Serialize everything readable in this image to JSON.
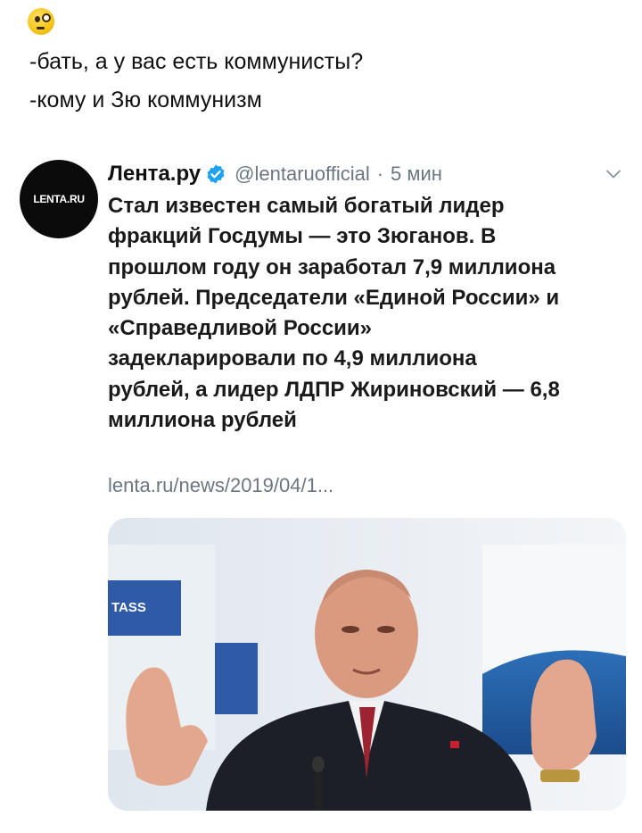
{
  "post": {
    "emoji_icon": "face-with-monocle-icon",
    "line1": "-бать, а у вас есть коммунисты?",
    "line2": "-кому и Зю коммунизм"
  },
  "tweet": {
    "avatar_text": "LENTA.RU",
    "author_name": "Лента.ру",
    "verified_icon": "verified-badge-icon",
    "handle": "@lentaruofficial",
    "separator": "·",
    "time": "5 мин",
    "menu_icon": "chevron-down-icon",
    "text_lines": [
      "Стал известен самый богатый лидер",
      "фракций Госдумы — это Зюганов. В",
      "прошлом году он заработал 7,9 миллиона",
      "рублей. Председатели «Единой России» и",
      "«Справедливой России»",
      "задекларировали по 4,9 миллиона",
      "рублей, а лидер ЛДПР Жириновский — 6,8",
      "миллиона рублей"
    ],
    "link": "lenta.ru/news/2019/04/1...",
    "photo": {
      "watermark": "TASS"
    }
  },
  "colors": {
    "secondary_text": "#6b7680",
    "verified_blue": "#1da1f2",
    "tass_blue": "#2f5aa8"
  }
}
